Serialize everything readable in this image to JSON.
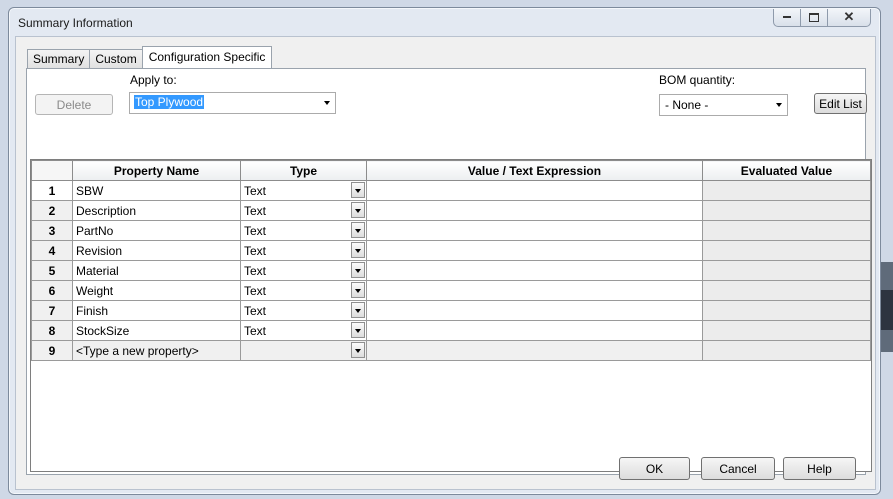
{
  "window": {
    "title": "Summary Information"
  },
  "tabs": [
    {
      "label": "Summary"
    },
    {
      "label": "Custom"
    },
    {
      "label": "Configuration Specific"
    }
  ],
  "apply_to": {
    "label": "Apply to:",
    "value": "Top Plywood"
  },
  "bom": {
    "label": "BOM quantity:",
    "value": "- None -"
  },
  "buttons": {
    "delete": "Delete",
    "edit_list": "Edit List",
    "ok": "OK",
    "cancel": "Cancel",
    "help": "Help"
  },
  "table": {
    "columns": [
      "Property Name",
      "Type",
      "Value / Text Expression",
      "Evaluated Value"
    ],
    "rows": [
      {
        "num": "1",
        "name": "SBW",
        "type": "Text",
        "value": "",
        "evaluated": ""
      },
      {
        "num": "2",
        "name": "Description",
        "type": "Text",
        "value": "",
        "evaluated": ""
      },
      {
        "num": "3",
        "name": "PartNo",
        "type": "Text",
        "value": "",
        "evaluated": ""
      },
      {
        "num": "4",
        "name": "Revision",
        "type": "Text",
        "value": "",
        "evaluated": ""
      },
      {
        "num": "5",
        "name": "Material",
        "type": "Text",
        "value": "",
        "evaluated": ""
      },
      {
        "num": "6",
        "name": "Weight",
        "type": "Text",
        "value": "",
        "evaluated": ""
      },
      {
        "num": "7",
        "name": "Finish",
        "type": "Text",
        "value": "",
        "evaluated": ""
      },
      {
        "num": "8",
        "name": "StockSize",
        "type": "Text",
        "value": "",
        "evaluated": ""
      },
      {
        "num": "9",
        "name": "<Type a new property>",
        "type": "",
        "value": "",
        "evaluated": ""
      }
    ]
  }
}
